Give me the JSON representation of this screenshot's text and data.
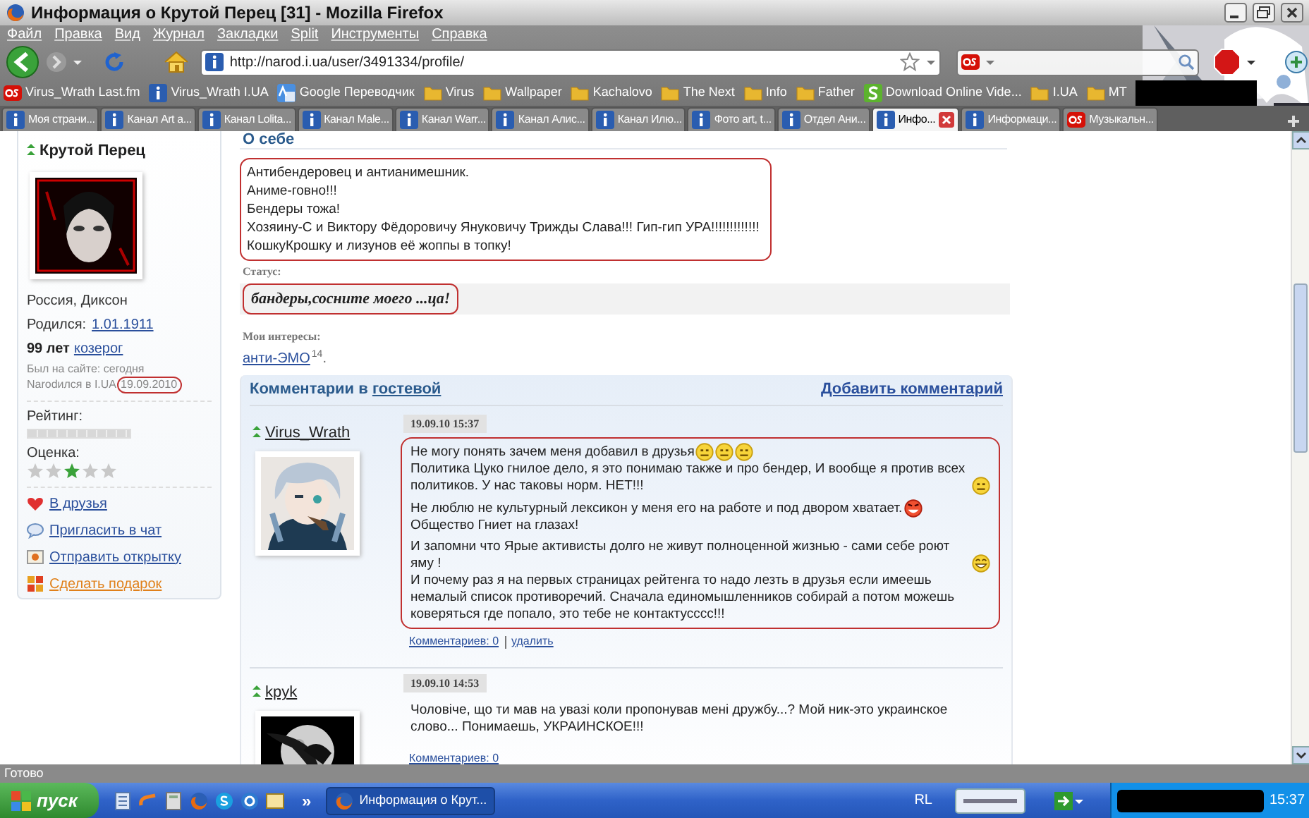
{
  "window": {
    "title": "Информация о Крутой Перец [31] - Mozilla Firefox"
  },
  "menu": [
    "Файл",
    "Правка",
    "Вид",
    "Журнал",
    "Закладки",
    "Split",
    "Инструменты",
    "Справка"
  ],
  "navigation": {
    "url": "http://narod.i.ua/user/3491334/profile/"
  },
  "bookmarks": [
    {
      "label": "Virus_Wrath Last.fm",
      "kind": "lastfm"
    },
    {
      "label": "Virus_Wrath I.UA",
      "kind": "info"
    },
    {
      "label": "Google Переводчик",
      "kind": "translate"
    },
    {
      "label": "Virus",
      "kind": "folder"
    },
    {
      "label": "Wallpaper",
      "kind": "folder"
    },
    {
      "label": "Kachalovo",
      "kind": "folder"
    },
    {
      "label": "The Next",
      "kind": "folder"
    },
    {
      "label": "Info",
      "kind": "folder"
    },
    {
      "label": "Father",
      "kind": "folder"
    },
    {
      "label": "Download Online Vide...",
      "kind": "download"
    },
    {
      "label": "I.UA",
      "kind": "folder"
    },
    {
      "label": "MT",
      "kind": "folder"
    }
  ],
  "tabs": [
    {
      "label": "Моя страни...",
      "kind": "info",
      "selected": false
    },
    {
      "label": "Канал Art a...",
      "kind": "info",
      "selected": false
    },
    {
      "label": "Канал Lolita...",
      "kind": "info",
      "selected": false
    },
    {
      "label": "Канал Male...",
      "kind": "info",
      "selected": false
    },
    {
      "label": "Канал Warr...",
      "kind": "info",
      "selected": false
    },
    {
      "label": "Канал Алис...",
      "kind": "info",
      "selected": false
    },
    {
      "label": "Канал Илю...",
      "kind": "info",
      "selected": false
    },
    {
      "label": "Фото art, t...",
      "kind": "info",
      "selected": false
    },
    {
      "label": "Отдел Ани...",
      "kind": "info",
      "selected": false
    },
    {
      "label": "Инфо...",
      "kind": "info",
      "selected": true
    },
    {
      "label": "Информаци...",
      "kind": "info",
      "selected": false
    },
    {
      "label": "Музыкальн...",
      "kind": "lastfm",
      "selected": false
    }
  ],
  "profile": {
    "name": "Крутой Перец",
    "location": "Россия, Диксон",
    "born_label": "Родился:",
    "born_date": "1.01.1911",
    "age": "99 лет",
    "zodiac": "козерог",
    "last_seen": "Был на сайте: сегодня",
    "joined_label": "Narodился в I.UA",
    "joined_date": "19.09.2010",
    "joined_date_circled": true,
    "rating_label": "Рейтинг:",
    "score_label": "Оценка:",
    "score_stars": [
      {
        "selected": false
      },
      {
        "selected": false
      },
      {
        "selected": true
      },
      {
        "selected": false
      },
      {
        "selected": false
      }
    ],
    "actions": [
      {
        "label": "В друзья",
        "kind": "friend"
      },
      {
        "label": "Пригласить в чат",
        "kind": "chat"
      },
      {
        "label": "Отправить открытку",
        "kind": "card"
      },
      {
        "label": "Сделать подарок",
        "kind": "gift"
      }
    ]
  },
  "about": {
    "heading": "О себе",
    "circled": true,
    "lines": [
      "Антибендеровец и антианимешник.",
      "Аниме-говно!!!",
      "Бендеры тожа!",
      "Хозяину-С и Виктору Фёдоровичу Януковичу Трижды Слава!!! Гип-гип УРА!!!!!!!!!!!!!",
      "КошкуКрошку и лизунов её жоппы в топку!"
    ],
    "status_label": "Статус:",
    "status": "бандеры,соснитe моего ...ца!",
    "status_circled": true,
    "interests_label": "Мои интересы:",
    "interests": [
      {
        "label": "анти-ЭМО",
        "count": "14",
        "suffix": "."
      }
    ]
  },
  "guestbook": {
    "heading": "Комментарии в ",
    "heading_link": "гостевой",
    "add_link": "Добавить комментарий",
    "comments": [
      {
        "author": "Virus_Wrath",
        "avatar": {
          "kind": "anime"
        },
        "date": "19.09.10 15:37",
        "circled": true,
        "blocks": [
          [
            {
              "text": "Не могу понять зачем меня добавил в друзья",
              "emoticons": [
                {
                  "kind": "meh"
                },
                {
                  "kind": "meh"
                },
                {
                  "kind": "meh"
                }
              ]
            },
            {
              "text": "Политика Цуко гнилое дело, я это понимаю также и про бендер, И вообще я против всех политиков. У нас таковы норм. НЕТ!!!",
              "emoticons": [
                {
                  "kind": "meh"
                }
              ]
            }
          ],
          [
            {
              "text": "Не люблю не культурный лексикон у меня его на работе и под двором хватает.",
              "emoticons": [
                {
                  "kind": "tongue"
                }
              ]
            },
            {
              "text": "Общество Гниет на глазах!"
            }
          ],
          [
            {
              "text": "И запомни что Ярые активисты долго не живут полноценной жизнью - сами себе роют яму !",
              "emoticons": [
                {
                  "kind": "grin"
                }
              ]
            },
            {
              "text": "И почему раз я на первых страницах рейтенга то надо лезть в друзья если имеешь немалый список противоречий. Сначала единомышленников собирай а потом можешь коверяться где попало, это тебе не контактусссс!!!"
            }
          ]
        ],
        "links": [
          "Комментариев: 0",
          "удалить"
        ]
      },
      {
        "author": "kpyk",
        "avatar": {
          "kind": "moon"
        },
        "date": "19.09.10 14:53",
        "circled": false,
        "blocks": [
          [
            {
              "text": "Чоловіче, що ти мав на увазі коли пропонував мені дружбу...? Мой ник-это украинское слово... Понимаешь, УКРАИНСКОЕ!!!"
            }
          ]
        ],
        "links": [
          "Комментариев: 0"
        ]
      }
    ]
  },
  "status_bar": "Готово",
  "taskbar": {
    "start": "пуск",
    "more": "»",
    "task": "Информация о Крут...",
    "tray_label": "RL",
    "clock": "15:37"
  }
}
